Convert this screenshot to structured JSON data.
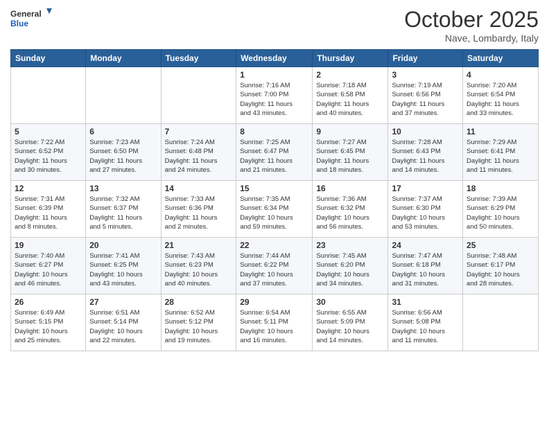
{
  "header": {
    "logo_line1": "General",
    "logo_line2": "Blue",
    "month": "October 2025",
    "location": "Nave, Lombardy, Italy"
  },
  "days_of_week": [
    "Sunday",
    "Monday",
    "Tuesday",
    "Wednesday",
    "Thursday",
    "Friday",
    "Saturday"
  ],
  "weeks": [
    [
      {
        "day": "",
        "info": ""
      },
      {
        "day": "",
        "info": ""
      },
      {
        "day": "",
        "info": ""
      },
      {
        "day": "1",
        "info": "Sunrise: 7:16 AM\nSunset: 7:00 PM\nDaylight: 11 hours\nand 43 minutes."
      },
      {
        "day": "2",
        "info": "Sunrise: 7:18 AM\nSunset: 6:58 PM\nDaylight: 11 hours\nand 40 minutes."
      },
      {
        "day": "3",
        "info": "Sunrise: 7:19 AM\nSunset: 6:56 PM\nDaylight: 11 hours\nand 37 minutes."
      },
      {
        "day": "4",
        "info": "Sunrise: 7:20 AM\nSunset: 6:54 PM\nDaylight: 11 hours\nand 33 minutes."
      }
    ],
    [
      {
        "day": "5",
        "info": "Sunrise: 7:22 AM\nSunset: 6:52 PM\nDaylight: 11 hours\nand 30 minutes."
      },
      {
        "day": "6",
        "info": "Sunrise: 7:23 AM\nSunset: 6:50 PM\nDaylight: 11 hours\nand 27 minutes."
      },
      {
        "day": "7",
        "info": "Sunrise: 7:24 AM\nSunset: 6:48 PM\nDaylight: 11 hours\nand 24 minutes."
      },
      {
        "day": "8",
        "info": "Sunrise: 7:25 AM\nSunset: 6:47 PM\nDaylight: 11 hours\nand 21 minutes."
      },
      {
        "day": "9",
        "info": "Sunrise: 7:27 AM\nSunset: 6:45 PM\nDaylight: 11 hours\nand 18 minutes."
      },
      {
        "day": "10",
        "info": "Sunrise: 7:28 AM\nSunset: 6:43 PM\nDaylight: 11 hours\nand 14 minutes."
      },
      {
        "day": "11",
        "info": "Sunrise: 7:29 AM\nSunset: 6:41 PM\nDaylight: 11 hours\nand 11 minutes."
      }
    ],
    [
      {
        "day": "12",
        "info": "Sunrise: 7:31 AM\nSunset: 6:39 PM\nDaylight: 11 hours\nand 8 minutes."
      },
      {
        "day": "13",
        "info": "Sunrise: 7:32 AM\nSunset: 6:37 PM\nDaylight: 11 hours\nand 5 minutes."
      },
      {
        "day": "14",
        "info": "Sunrise: 7:33 AM\nSunset: 6:36 PM\nDaylight: 11 hours\nand 2 minutes."
      },
      {
        "day": "15",
        "info": "Sunrise: 7:35 AM\nSunset: 6:34 PM\nDaylight: 10 hours\nand 59 minutes."
      },
      {
        "day": "16",
        "info": "Sunrise: 7:36 AM\nSunset: 6:32 PM\nDaylight: 10 hours\nand 56 minutes."
      },
      {
        "day": "17",
        "info": "Sunrise: 7:37 AM\nSunset: 6:30 PM\nDaylight: 10 hours\nand 53 minutes."
      },
      {
        "day": "18",
        "info": "Sunrise: 7:39 AM\nSunset: 6:29 PM\nDaylight: 10 hours\nand 50 minutes."
      }
    ],
    [
      {
        "day": "19",
        "info": "Sunrise: 7:40 AM\nSunset: 6:27 PM\nDaylight: 10 hours\nand 46 minutes."
      },
      {
        "day": "20",
        "info": "Sunrise: 7:41 AM\nSunset: 6:25 PM\nDaylight: 10 hours\nand 43 minutes."
      },
      {
        "day": "21",
        "info": "Sunrise: 7:43 AM\nSunset: 6:23 PM\nDaylight: 10 hours\nand 40 minutes."
      },
      {
        "day": "22",
        "info": "Sunrise: 7:44 AM\nSunset: 6:22 PM\nDaylight: 10 hours\nand 37 minutes."
      },
      {
        "day": "23",
        "info": "Sunrise: 7:45 AM\nSunset: 6:20 PM\nDaylight: 10 hours\nand 34 minutes."
      },
      {
        "day": "24",
        "info": "Sunrise: 7:47 AM\nSunset: 6:18 PM\nDaylight: 10 hours\nand 31 minutes."
      },
      {
        "day": "25",
        "info": "Sunrise: 7:48 AM\nSunset: 6:17 PM\nDaylight: 10 hours\nand 28 minutes."
      }
    ],
    [
      {
        "day": "26",
        "info": "Sunrise: 6:49 AM\nSunset: 5:15 PM\nDaylight: 10 hours\nand 25 minutes."
      },
      {
        "day": "27",
        "info": "Sunrise: 6:51 AM\nSunset: 5:14 PM\nDaylight: 10 hours\nand 22 minutes."
      },
      {
        "day": "28",
        "info": "Sunrise: 6:52 AM\nSunset: 5:12 PM\nDaylight: 10 hours\nand 19 minutes."
      },
      {
        "day": "29",
        "info": "Sunrise: 6:54 AM\nSunset: 5:11 PM\nDaylight: 10 hours\nand 16 minutes."
      },
      {
        "day": "30",
        "info": "Sunrise: 6:55 AM\nSunset: 5:09 PM\nDaylight: 10 hours\nand 14 minutes."
      },
      {
        "day": "31",
        "info": "Sunrise: 6:56 AM\nSunset: 5:08 PM\nDaylight: 10 hours\nand 11 minutes."
      },
      {
        "day": "",
        "info": ""
      }
    ]
  ]
}
